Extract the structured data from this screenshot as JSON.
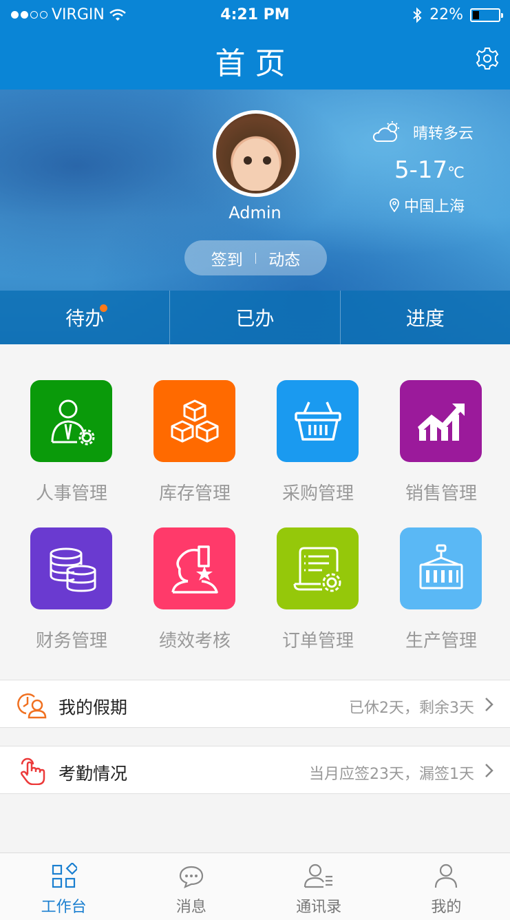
{
  "status_bar": {
    "carrier": "VIRGIN",
    "time": "4:21 PM",
    "battery": "22%"
  },
  "nav": {
    "title": "首页"
  },
  "profile": {
    "name": "Admin",
    "checkin_label": "签到",
    "activity_label": "动态"
  },
  "weather": {
    "condition": "晴转多云",
    "temp": "5-17",
    "unit": "℃",
    "location": "中国上海"
  },
  "tabs": [
    {
      "label": "待办",
      "has_badge": true
    },
    {
      "label": "已办"
    },
    {
      "label": "进度"
    }
  ],
  "modules": [
    {
      "label": "人事管理",
      "color": "#0a9a0a",
      "icon": "person-gear-icon"
    },
    {
      "label": "库存管理",
      "color": "#ff6a00",
      "icon": "boxes-icon"
    },
    {
      "label": "采购管理",
      "color": "#1a9af0",
      "icon": "basket-icon"
    },
    {
      "label": "销售管理",
      "color": "#9b1a9b",
      "icon": "chart-up-icon"
    },
    {
      "label": "财务管理",
      "color": "#6a3ad0",
      "icon": "coins-icon"
    },
    {
      "label": "绩效考核",
      "color": "#ff3a6a",
      "icon": "person-star-icon"
    },
    {
      "label": "订单管理",
      "color": "#95c80a",
      "icon": "document-gear-icon"
    },
    {
      "label": "生产管理",
      "color": "#5ab8f5",
      "icon": "container-icon"
    }
  ],
  "leave": {
    "title": "我的假期",
    "value": "已休2天，剩余3天"
  },
  "attendance": {
    "title": "考勤情况",
    "value": "当月应签23天，漏签1天"
  },
  "bottom_tabs": [
    {
      "label": "工作台",
      "active": true
    },
    {
      "label": "消息"
    },
    {
      "label": "通讯录"
    },
    {
      "label": "我的"
    }
  ]
}
